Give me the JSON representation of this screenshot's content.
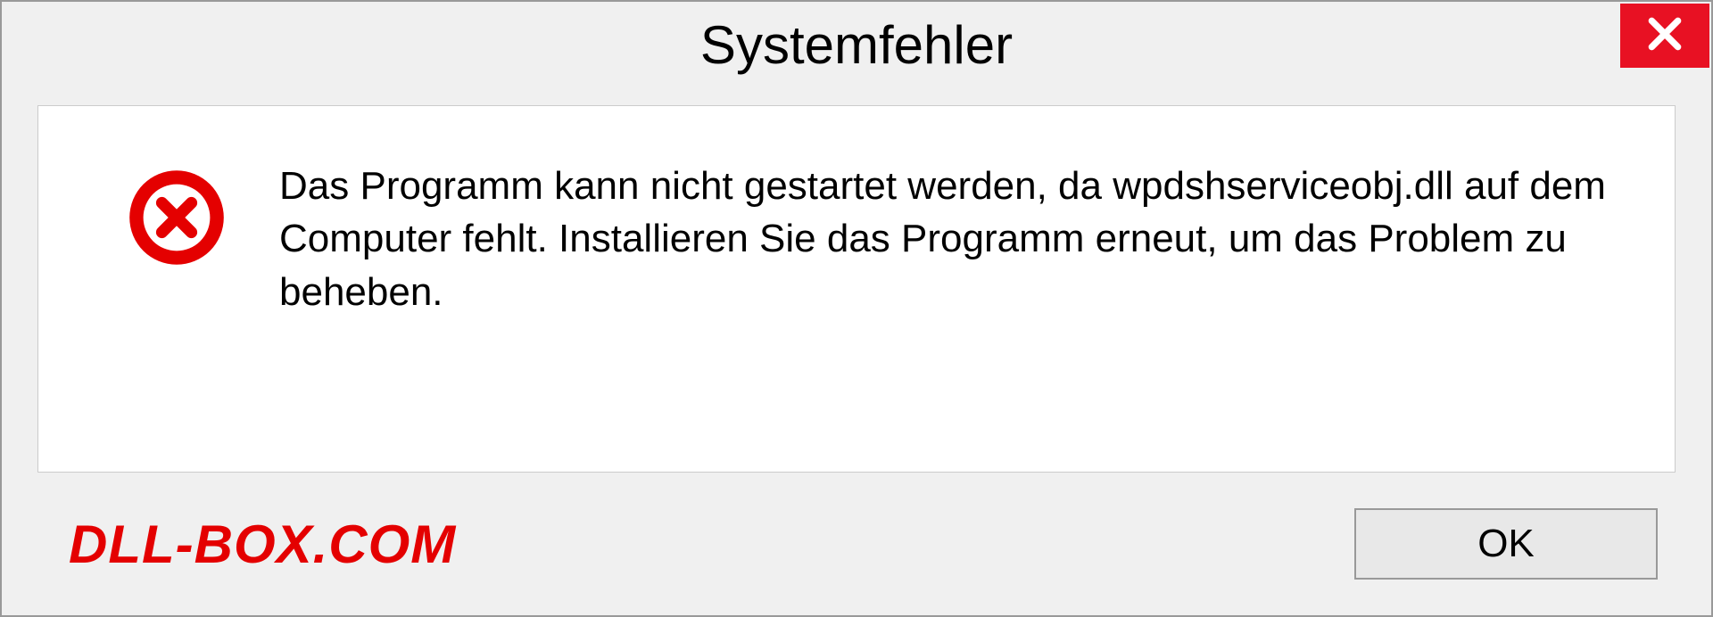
{
  "dialog": {
    "title": "Systemfehler",
    "message": "Das Programm kann nicht gestartet werden, da wpdshserviceobj.dll auf dem Computer fehlt. Installieren Sie das Programm erneut, um das Problem zu beheben.",
    "ok_label": "OK"
  },
  "watermark": "DLL-BOX.COM"
}
